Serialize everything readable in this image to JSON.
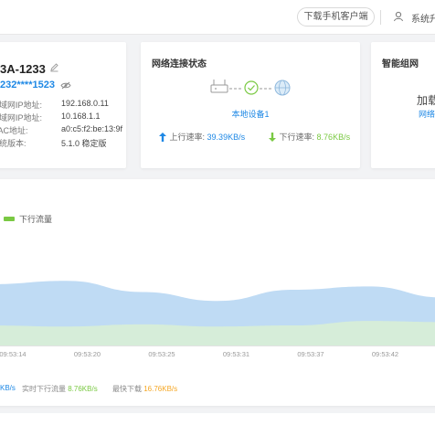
{
  "topbar": {
    "app_download": "下载手机客户端",
    "settings_partial": "系统升级"
  },
  "device": {
    "name": "3A-1233",
    "password": "232****1523",
    "rows": [
      {
        "label": "广域网IP地址:",
        "value": "192.168.0.11"
      },
      {
        "label": "局域网IP地址:",
        "value": "10.168.1.1"
      },
      {
        "label": "MAC地址:",
        "value": "a0:c5:f2:be:13:9f"
      },
      {
        "label": "系统版本:",
        "value": "5.1.0 稳定版"
      }
    ]
  },
  "network": {
    "title": "网络连接状态",
    "local_device": "本地设备1",
    "up_label": "上行速率:",
    "up_value": "39.39KB/s",
    "down_label": "下行速率:",
    "down_value": "8.76KB/s"
  },
  "mesh": {
    "title": "智能组网",
    "join_text": "加载",
    "link_text": "网络"
  },
  "chart": {
    "legend_down": "下行流量",
    "stats": {
      "up_value_partial": "KB/s",
      "down_label": "实时下行流量",
      "down_value": "8.76KB/s",
      "max_label": "最快下载",
      "max_value": "16.76KB/s"
    }
  },
  "chart_data": {
    "type": "area",
    "x": [
      "09:53:14",
      "09:53:20",
      "09:53:25",
      "09:53:31",
      "09:53:37",
      "09:53:42"
    ],
    "series": [
      {
        "name": "",
        "values": [
          55,
          58,
          48,
          40,
          50,
          53,
          43
        ],
        "color": "#bcd9f3"
      },
      {
        "name": "下行流量",
        "values": [
          18,
          17,
          19,
          17,
          18,
          22,
          21
        ],
        "color": "#d8eed6"
      }
    ],
    "ylim": [
      0,
      100
    ],
    "grid": false
  },
  "colors": {
    "accent_blue": "#1e88e5",
    "accent_green": "#7ac943",
    "accent_orange": "#f5a623"
  }
}
